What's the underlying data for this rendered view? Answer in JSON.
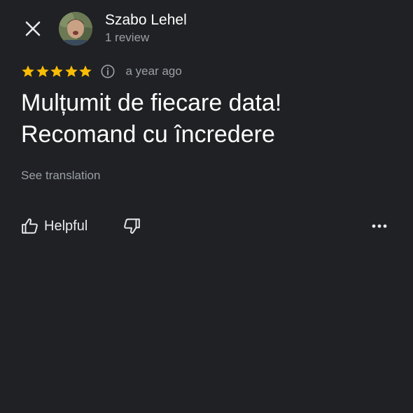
{
  "header": {
    "close_icon": "close-icon",
    "author": {
      "name": "Szabo Lehel",
      "review_count": "1 review",
      "avatar_icon": "avatar-photo"
    }
  },
  "review": {
    "rating": 5,
    "max_rating": 5,
    "star_color": "#fbbc04",
    "info_icon": "info-icon",
    "time_ago": "a year ago",
    "text_line1": "Mulțumit de fiecare data!",
    "text_line2": "Recomand cu încredere",
    "see_translation": "See translation"
  },
  "actions": {
    "helpful_label": "Helpful",
    "helpful_icon": "thumbs-up-icon",
    "dislike_icon": "thumbs-down-icon",
    "more_icon": "more-horizontal-icon"
  },
  "colors": {
    "background": "#202124",
    "primary_text": "#ffffff",
    "secondary_text": "#9aa0a6"
  }
}
